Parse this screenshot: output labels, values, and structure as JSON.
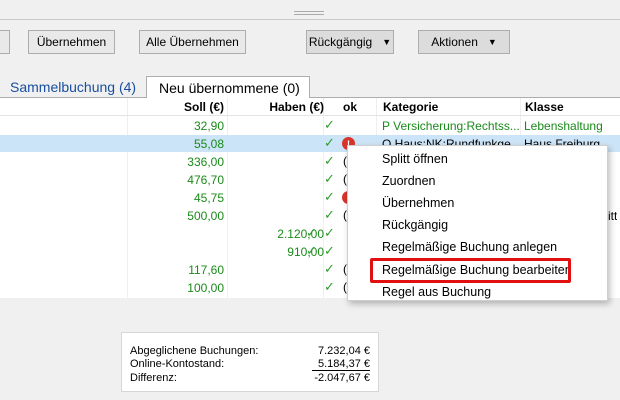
{
  "toolbar": {
    "uebernehmen": "Übernehmen",
    "alle_uebernehmen": "Alle Übernehmen",
    "rueckgaengig": "Rückgängig",
    "aktionen": "Aktionen"
  },
  "tabs": {
    "sammel": "Sammelbuchung (4)",
    "neu": "Neu übernommene (0)"
  },
  "columns": {
    "soll": "Soll (€)",
    "haben": "Haben (€)",
    "ok": "ok",
    "kategorie": "Kategorie",
    "klasse": "Klasse"
  },
  "rows": [
    {
      "soll": "32,90",
      "haben": "",
      "ok": "✓",
      "kategorie": "P Versicherung:Rechtss...",
      "klasse": "Lebenshaltung"
    },
    {
      "soll": "55,08",
      "haben": "",
      "ok": "✓",
      "kategorie": "O Haus:NK:Rundfunkge...",
      "klasse": "Haus Freiburg"
    },
    {
      "soll": "336,00",
      "haben": "",
      "ok": "✓",
      "kategorie": "",
      "klasse": ""
    },
    {
      "soll": "476,70",
      "haben": "",
      "ok": "✓",
      "kategorie": "",
      "klasse": ""
    },
    {
      "soll": "45,75",
      "haben": "",
      "ok": "✓",
      "kategorie": "",
      "klasse": ""
    },
    {
      "soll": "500,00",
      "haben": "",
      "ok": "✓",
      "kategorie": "",
      "klasse": "itt"
    },
    {
      "soll": "",
      "haben": "2.120,00",
      "ok": "✓",
      "kategorie": "",
      "klasse": ""
    },
    {
      "soll": "",
      "haben": "910,00",
      "ok": "✓",
      "kategorie": "",
      "klasse": ""
    },
    {
      "soll": "117,60",
      "haben": "",
      "ok": "✓",
      "kategorie": "",
      "klasse": ""
    },
    {
      "soll": "100,00",
      "haben": "",
      "ok": "✓",
      "kategorie": "",
      "klasse": ""
    }
  ],
  "summary": {
    "abgeglichen_label": "Abgeglichene Buchungen:",
    "abgeglichen_value": "7.232,04 €",
    "online_label": "Online-Kontostand:",
    "online_value": "5.184,37 €",
    "differenz_label": "Differenz:",
    "differenz_value": "-2.047,67 €"
  },
  "context_menu": {
    "items": [
      "Splitt öffnen",
      "Zuordnen",
      "Übernehmen",
      "Rückgängig",
      "Regelmäßige Buchung anlegen",
      "Regelmäßige Buchung bearbeiten",
      "Regel aus Buchung"
    ]
  },
  "colors": {
    "green_text": "#1a8a1a",
    "selection": "#cce4f7",
    "highlight_box": "#e01010",
    "tab_link": "#1a4fa0"
  }
}
